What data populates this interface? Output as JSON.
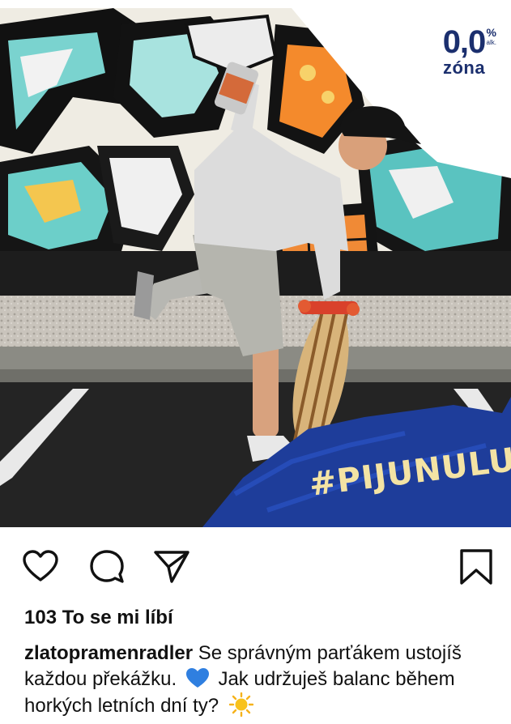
{
  "brand": {
    "logo_number": "0,0",
    "logo_percent": "%",
    "logo_alk": "alk.",
    "logo_word": "zóna"
  },
  "post": {
    "hashtag": "#PIJUNULU",
    "likes_text": "103 To se mi líbí",
    "username": "zlatopramenradler",
    "caption_part1": "Se správným parťákem ustojíš každou překážku.",
    "caption_part2": "Jak udržuješ balanc během horkých letních dní ty?",
    "caption_emojis": [
      "blue-heart",
      "sun"
    ]
  },
  "actions": {
    "icons": [
      "heart-icon",
      "comment-icon",
      "share-icon",
      "bookmark-icon"
    ]
  },
  "colors": {
    "brand_navy": "#1b2f6e",
    "paint_blue": "#1e3d9a",
    "hashtag_cream": "#f3e3a4"
  }
}
